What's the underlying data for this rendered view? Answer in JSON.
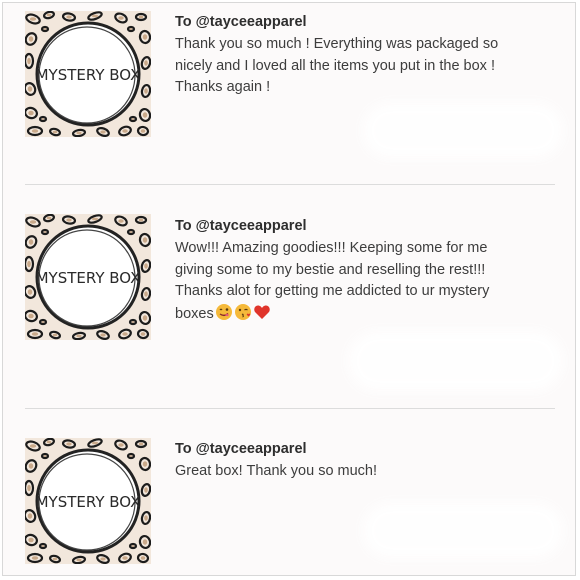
{
  "reviews": [
    {
      "recipient": "To @tayceeapparel",
      "lines": [
        "Thank you so much ! Everything was packaged so",
        "nicely and I loved all the items you put in the box !",
        "Thanks again !"
      ],
      "thumbnail_text": "MYSTERY BOX"
    },
    {
      "recipient": "To @tayceeapparel",
      "lines": [
        "Wow!!! Amazing goodies!!! Keeping some for me",
        "giving some to my bestie and reselling the rest!!!",
        "Thanks alot for getting me addicted to ur mystery",
        "boxes"
      ],
      "emojis": [
        "drooling-face",
        "kissing-face",
        "red-heart"
      ],
      "thumbnail_text": "MYSTERY BOX"
    },
    {
      "recipient": "To @tayceeapparel",
      "lines": [
        "Great box! Thank you so much!"
      ],
      "thumbnail_text": "MYSTERY BOX"
    }
  ],
  "colors": {
    "leopard_bg": "#f2e7dc",
    "spot": "#1c1c1c",
    "circle_fill": "#ffffff",
    "text": "#3d3d3d",
    "heart": "#e0342b",
    "emoji_face": "#f5b93a"
  }
}
